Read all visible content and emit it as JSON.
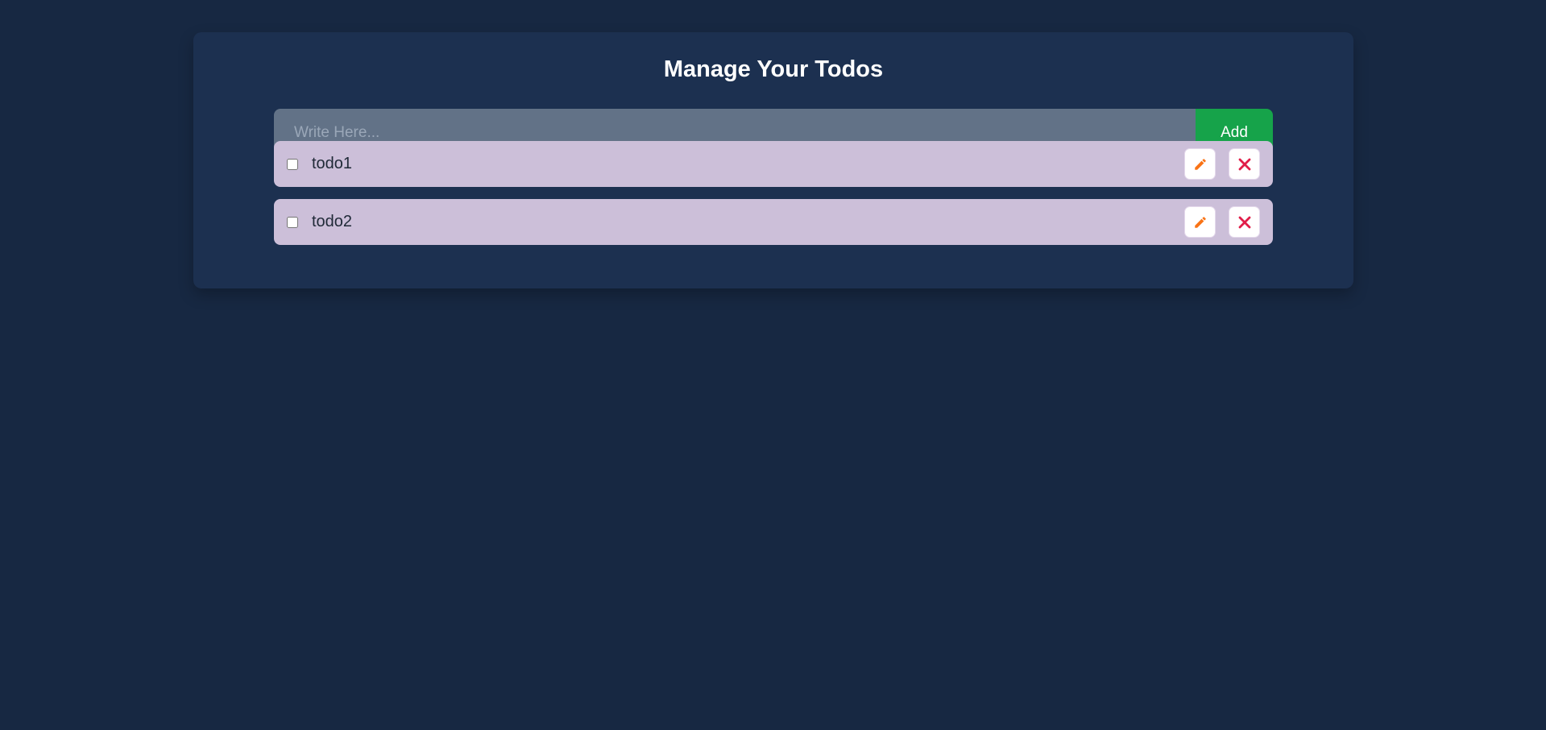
{
  "header": {
    "title": "Manage Your Todos"
  },
  "form": {
    "placeholder": "Write Here...",
    "value": "",
    "add_label": "Add"
  },
  "todos": [
    {
      "text": "todo1",
      "completed": false
    },
    {
      "text": "todo2",
      "completed": false
    }
  ],
  "icons": {
    "edit": "pencil-icon",
    "delete": "close-icon"
  },
  "colors": {
    "background": "#172842",
    "card": "#1c3050",
    "input": "#627287",
    "add_button": "#16a34a",
    "todo_item": "#ccbfd9",
    "edit_icon": "#f97316",
    "delete_icon": "#e11d48"
  }
}
